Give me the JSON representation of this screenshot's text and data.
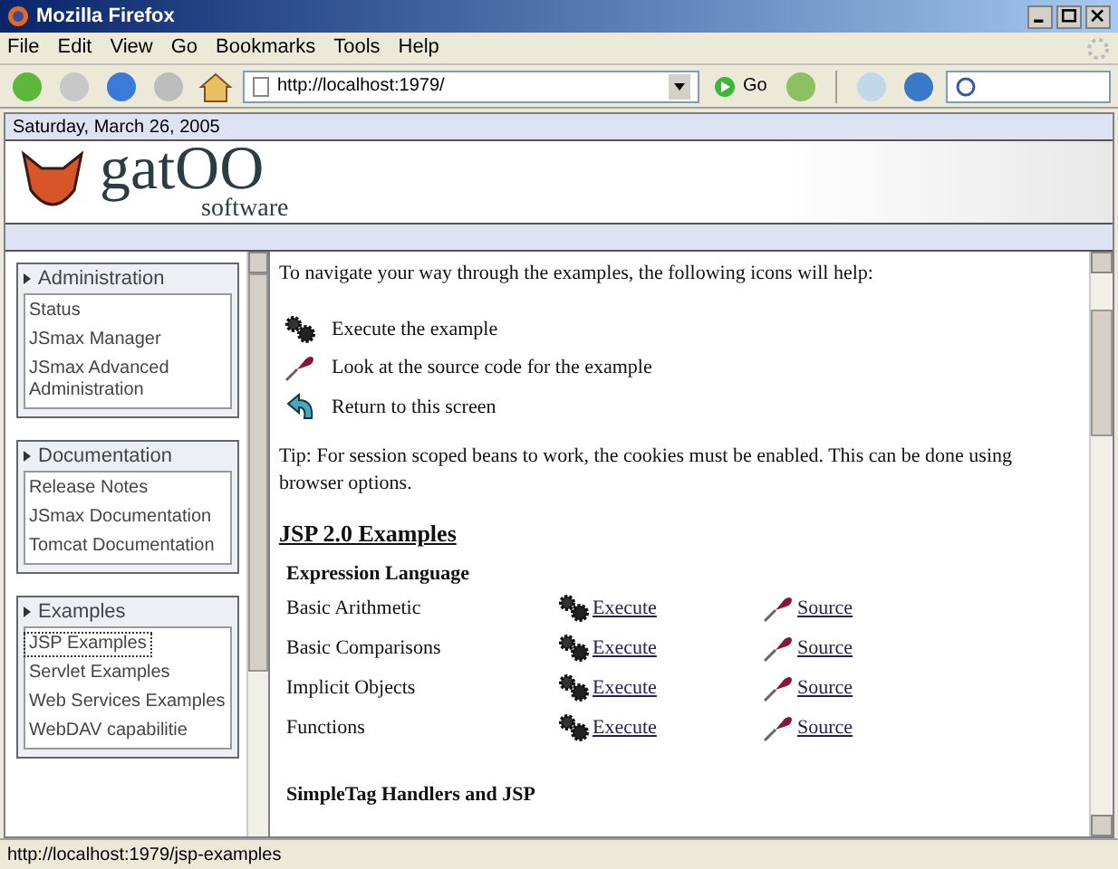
{
  "window": {
    "title": "Mozilla Firefox"
  },
  "menu": [
    "File",
    "Edit",
    "View",
    "Go",
    "Bookmarks",
    "Tools",
    "Help"
  ],
  "toolbar": {
    "url": "http://localhost:1979/",
    "go": "Go"
  },
  "page": {
    "date": "Saturday, March 26, 2005",
    "logo": {
      "name": "gatOO",
      "tagline": "software"
    },
    "sidebar": [
      {
        "title": "Administration",
        "items": [
          {
            "label": "Status",
            "selected": false
          },
          {
            "label": "JSmax Manager",
            "selected": false
          },
          {
            "label": "JSmax Advanced Administration",
            "selected": false
          }
        ]
      },
      {
        "title": "Documentation",
        "items": [
          {
            "label": "Release Notes",
            "selected": false
          },
          {
            "label": "JSmax Documentation",
            "selected": false
          },
          {
            "label": "Tomcat Documentation",
            "selected": false
          }
        ]
      },
      {
        "title": "Examples",
        "items": [
          {
            "label": "JSP Examples",
            "selected": true
          },
          {
            "label": "Servlet Examples",
            "selected": false
          },
          {
            "label": "Web Services Examples",
            "selected": false
          },
          {
            "label": "WebDAV capabilitie",
            "selected": false
          }
        ]
      }
    ],
    "intro": "To navigate your way through the examples, the following icons will help:",
    "legend": [
      {
        "kind": "execute",
        "text": "Execute the example"
      },
      {
        "kind": "source",
        "text": "Look at the source code for the example"
      },
      {
        "kind": "return",
        "text": "Return to this screen"
      }
    ],
    "tip": "Tip: For session scoped beans to work, the cookies must be enabled. This can be done using browser options.",
    "section": "JSP 2.0 Examples",
    "groups": [
      {
        "title": "Expression Language",
        "rows": [
          {
            "name": "Basic Arithmetic",
            "execute": "Execute",
            "source": "Source"
          },
          {
            "name": "Basic Comparisons",
            "execute": "Execute",
            "source": "Source"
          },
          {
            "name": "Implicit Objects",
            "execute": "Execute",
            "source": "Source"
          },
          {
            "name": "Functions",
            "execute": "Execute",
            "source": "Source"
          }
        ]
      },
      {
        "title": "SimpleTag Handlers and JSP"
      }
    ]
  },
  "status_bar": {
    "text": "http://localhost:1979/jsp-examples"
  }
}
